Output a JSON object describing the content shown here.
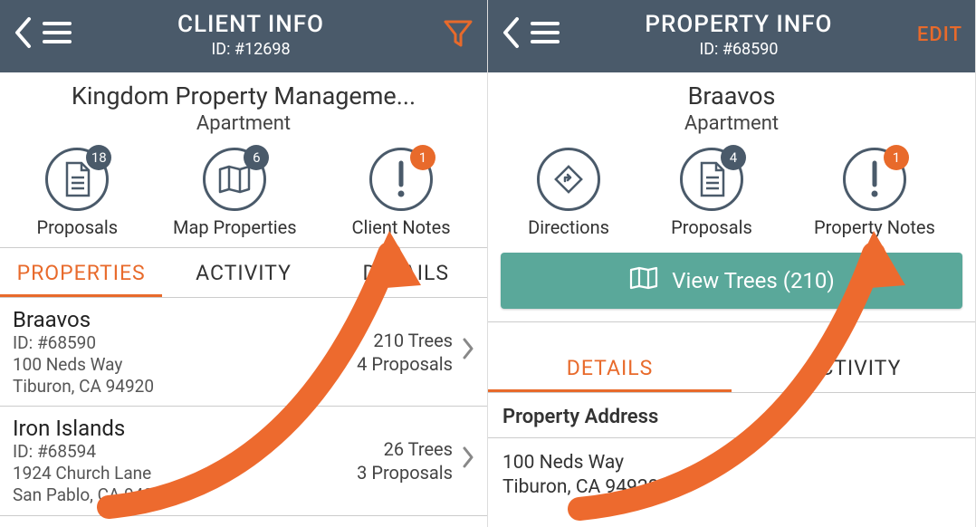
{
  "left": {
    "header": {
      "title": "CLIENT INFO",
      "id_label": "ID: #12698"
    },
    "info": {
      "name": "Kingdom Property Manageme...",
      "type": "Apartment"
    },
    "actions": {
      "proposals": {
        "label": "Proposals",
        "badge": "18"
      },
      "map": {
        "label": "Map Properties",
        "badge": "6"
      },
      "notes": {
        "label": "Client Notes",
        "badge": "1"
      }
    },
    "tabs": {
      "properties": "PROPERTIES",
      "activity": "ACTIVITY",
      "details": "DETAILS"
    },
    "rows": [
      {
        "name": "Braavos",
        "id": "ID: #68590",
        "addr1": "100 Neds Way",
        "addr2": "Tiburon, CA 94920",
        "trees": "210 Trees",
        "proposals": "4 Proposals"
      },
      {
        "name": "Iron Islands",
        "id": "ID: #68594",
        "addr1": "1924 Church Lane",
        "addr2": "San Pablo, CA 94806",
        "trees": "26 Trees",
        "proposals": "3 Proposals"
      }
    ]
  },
  "right": {
    "header": {
      "title": "PROPERTY INFO",
      "id_label": "ID: #68590",
      "edit": "EDIT"
    },
    "info": {
      "name": "Braavos",
      "type": "Apartment"
    },
    "actions": {
      "directions": {
        "label": "Directions"
      },
      "proposals": {
        "label": "Proposals",
        "badge": "4"
      },
      "notes": {
        "label": "Property Notes",
        "badge": "1"
      }
    },
    "view_trees": "View Trees (210)",
    "tabs": {
      "details": "DETAILS",
      "activity": "ACTIVITY"
    },
    "section_header": "Property Address",
    "address": {
      "line1": "100 Neds Way",
      "line2": "Tiburon, CA 94920"
    }
  }
}
